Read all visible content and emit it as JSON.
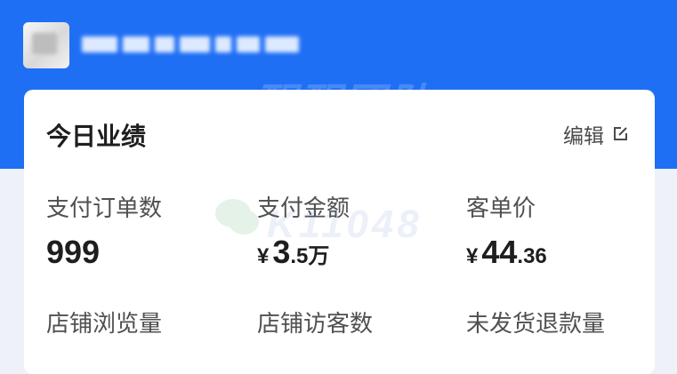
{
  "header": {
    "store_name_blurred": true
  },
  "watermark": {
    "text": "醒醒团队",
    "id": "K11048"
  },
  "card": {
    "title": "今日业绩",
    "edit_label": "编辑",
    "metrics": [
      {
        "label": "支付订单数",
        "value": "999"
      },
      {
        "label": "支付金额",
        "currency": "¥",
        "value_main": "3",
        "value_small": ".5",
        "unit": "万"
      },
      {
        "label": "客单价",
        "currency": "¥",
        "value_main": "44",
        "value_small": ".36"
      },
      {
        "label": "店铺浏览量"
      },
      {
        "label": "店铺访客数"
      },
      {
        "label": "未发货退款量"
      }
    ]
  },
  "colors": {
    "header_blue": "#1f6ff5",
    "card_bg": "#ffffff",
    "page_bg": "#eef2f8",
    "text_primary": "#1e1e1e",
    "text_secondary": "#505050"
  },
  "icons": {
    "edit": "external-edit-icon",
    "avatar": "store-avatar",
    "chat": "wechat-icon"
  }
}
